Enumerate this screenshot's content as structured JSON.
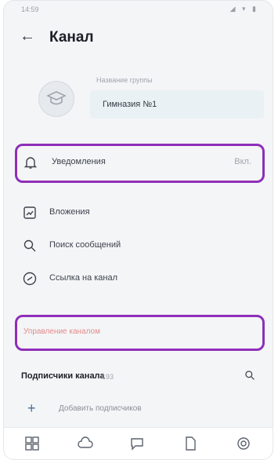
{
  "status": {
    "time": "14:59",
    "icons": "◢ ▾ ▮"
  },
  "header": {
    "title": "Канал"
  },
  "channel": {
    "name_label": "Название группы",
    "name_value": "Гимназия №1"
  },
  "rows": {
    "notifications": {
      "label": "Уведомления",
      "value": "Вкл."
    },
    "media": {
      "label": "Вложения"
    },
    "search": {
      "label": "Поиск сообщений"
    },
    "link": {
      "label": "Ссылка на канал"
    },
    "manage": {
      "label": "Управление каналом"
    }
  },
  "subscribers": {
    "title": "Подписчики канала",
    "count": "193",
    "add_label": "Добавить подписчиков"
  },
  "colors": {
    "highlight": "#8e2fb8",
    "accent": "#4a6e8f"
  }
}
